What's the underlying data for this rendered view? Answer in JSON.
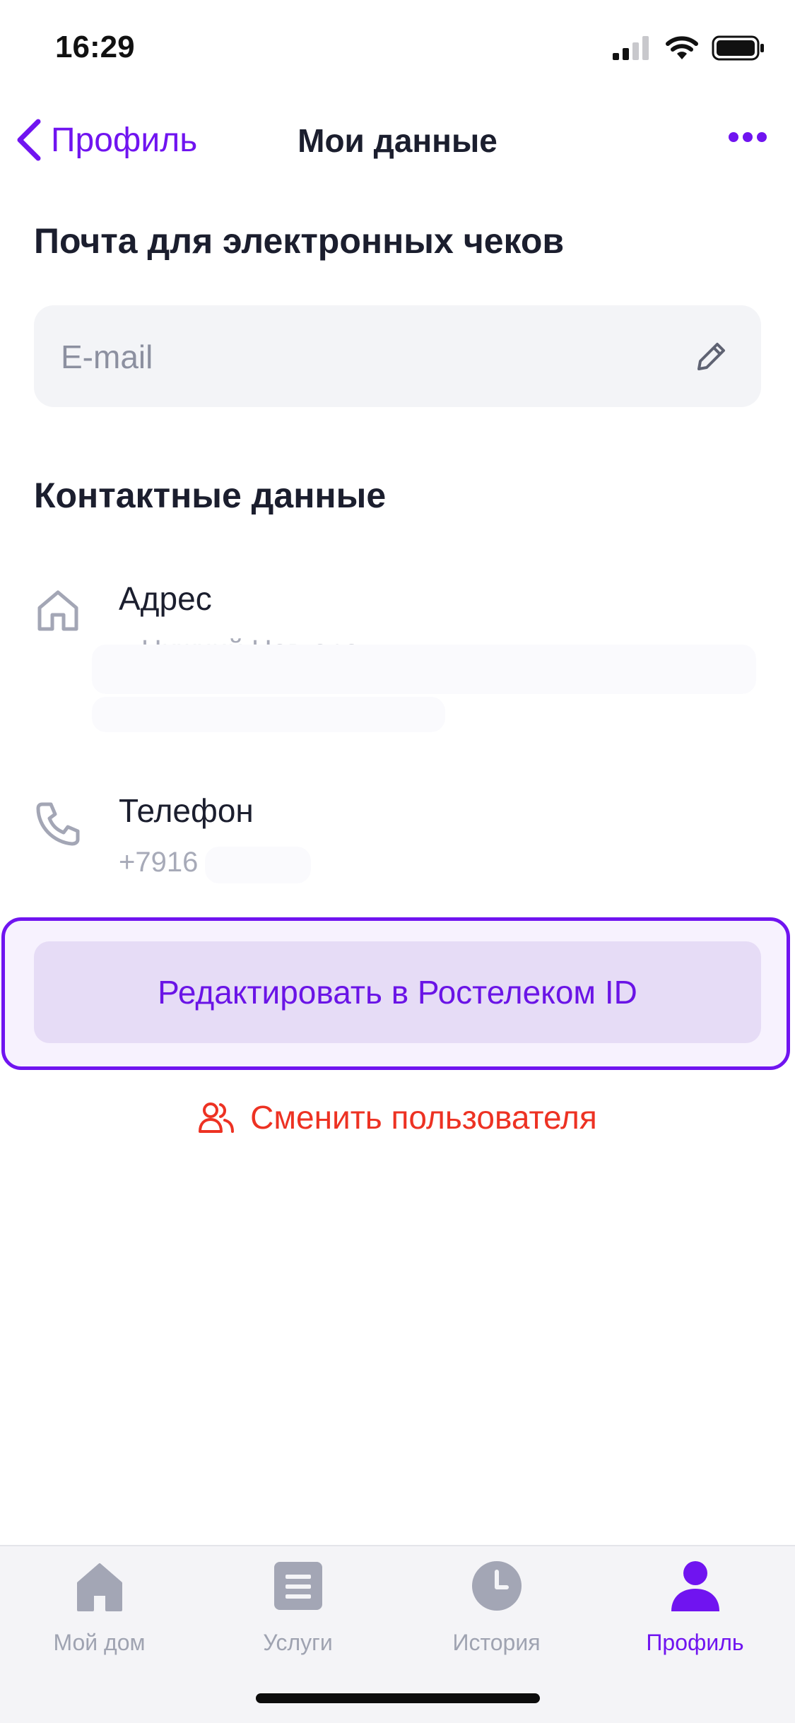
{
  "status_bar": {
    "time": "16:29"
  },
  "nav": {
    "back_label": "Профиль",
    "title": "Мои данные"
  },
  "email_section": {
    "title": "Почта для электронных чеков",
    "placeholder": "E-mail",
    "value": ""
  },
  "contacts": {
    "title": "Контактные данные",
    "address": {
      "label": "Адрес",
      "value": "г. Нижний Новгород"
    },
    "phone": {
      "label": "Телефон",
      "value": "+7916"
    }
  },
  "actions": {
    "edit_button_label": "Редактировать в Ростелеком ID",
    "switch_user_label": "Сменить пользователя"
  },
  "tabs": [
    {
      "label": "Мой дом",
      "icon": "home-icon",
      "active": false
    },
    {
      "label": "Услуги",
      "icon": "services-icon",
      "active": false
    },
    {
      "label": "История",
      "icon": "clock-icon",
      "active": false
    },
    {
      "label": "Профиль",
      "icon": "profile-icon",
      "active": true
    }
  ],
  "colors": {
    "accent": "#7014f0",
    "danger": "#ed3223",
    "muted": "#a7aab8",
    "text": "#1b1e2e"
  }
}
